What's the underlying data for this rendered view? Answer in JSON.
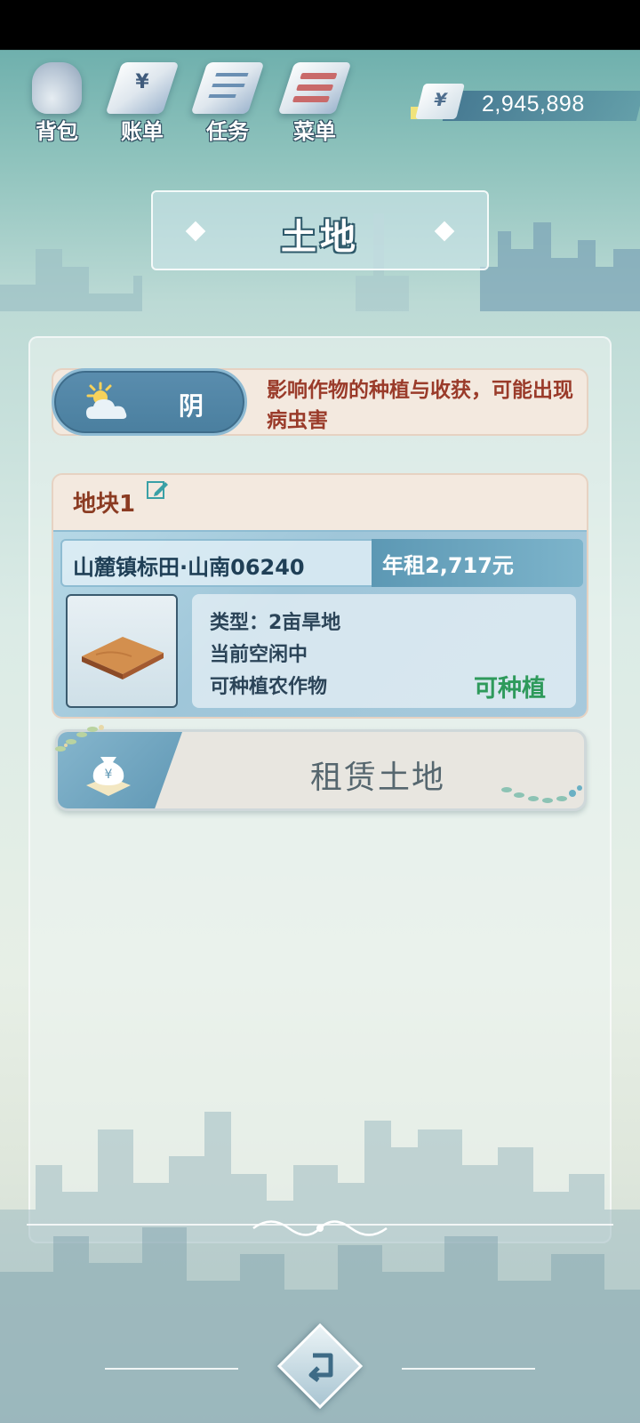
{
  "top_nav": {
    "items": [
      {
        "label": "背包",
        "icon": "backpack-icon"
      },
      {
        "label": "账单",
        "icon": "bill-icon",
        "glyph": "¥"
      },
      {
        "label": "任务",
        "icon": "task-icon"
      },
      {
        "label": "菜单",
        "icon": "menu-icon"
      }
    ],
    "currency": {
      "symbol": "¥",
      "value": "2,945,898"
    }
  },
  "page": {
    "title": "土地"
  },
  "weather": {
    "label": "阴",
    "icon": "cloudy-sun-icon",
    "description": "影响作物的种植与收获，可能出现病虫害"
  },
  "plot": {
    "name": "地块1",
    "edit_icon": "edit-icon",
    "address": "山麓镇标田·山南06240",
    "rent": "年租2,717元",
    "type_line": "类型：2亩旱地",
    "state_line": "当前空闲中",
    "crop_line": "可种植农作物",
    "status": "可种植",
    "thumbnail_icon": "soil-plot-icon"
  },
  "actions": {
    "rent_land_label": "租赁土地",
    "rent_land_icon": "money-bag-icon",
    "back_icon": "back-arrow-icon"
  },
  "colors": {
    "accent_blue": "#5a8dae",
    "plot_title": "#8b3b22",
    "warning_text": "#9a3b2a",
    "plantable_green": "#2e9a5b"
  }
}
